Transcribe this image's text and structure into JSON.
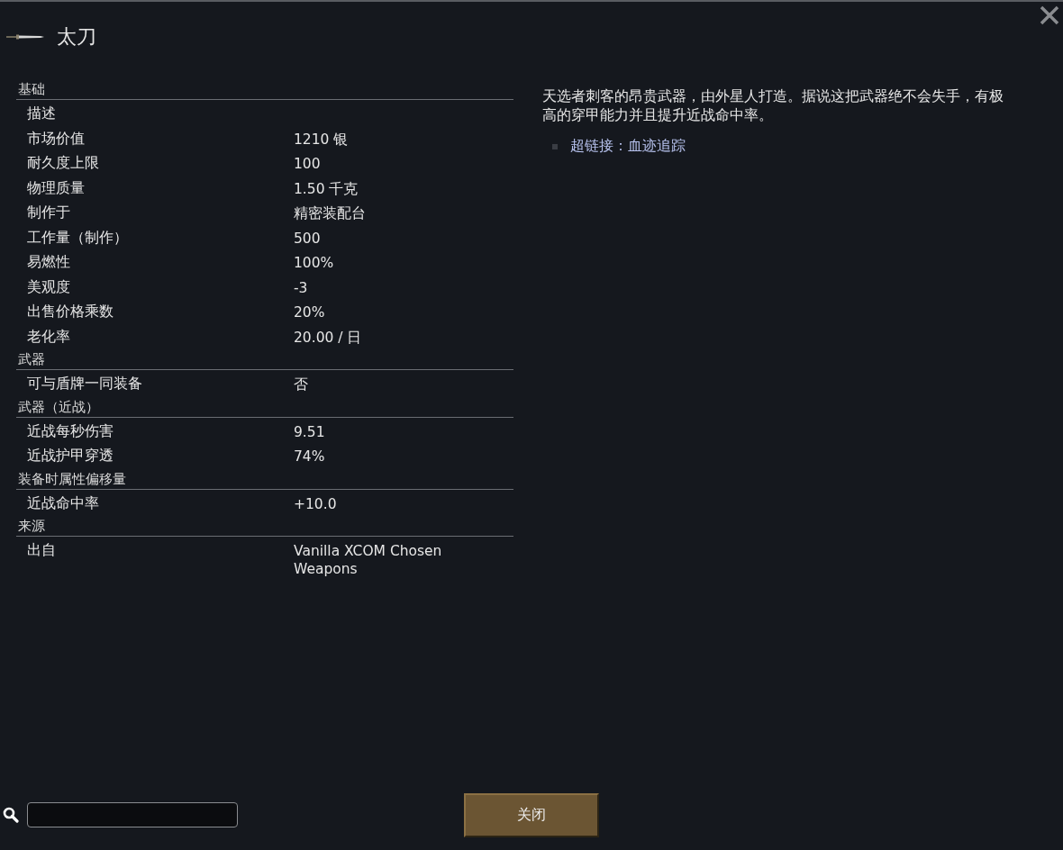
{
  "title": "太刀",
  "sections": [
    {
      "heading": "基础",
      "rows": [
        {
          "label": "描述"
        },
        {
          "label": "市场价值",
          "value": "1210 银"
        },
        {
          "label": "耐久度上限",
          "value": "100"
        },
        {
          "label": "物理质量",
          "value": "1.50 千克"
        },
        {
          "label": "制作于",
          "value": "精密装配台"
        },
        {
          "label": "工作量（制作）",
          "value": "500"
        },
        {
          "label": "易燃性",
          "value": "100%"
        },
        {
          "label": "美观度",
          "value": "-3"
        },
        {
          "label": "出售价格乘数",
          "value": "20%"
        },
        {
          "label": "老化率",
          "value": "20.00 / 日"
        }
      ]
    },
    {
      "heading": "武器",
      "rows": [
        {
          "label": "可与盾牌一同装备",
          "value": "否"
        }
      ]
    },
    {
      "heading": "武器（近战）",
      "rows": [
        {
          "label": "近战每秒伤害",
          "value": "9.51"
        },
        {
          "label": "近战护甲穿透",
          "value": "74%"
        }
      ]
    },
    {
      "heading": "装备时属性偏移量",
      "rows": [
        {
          "label": "近战命中率",
          "value": "+10.0"
        }
      ]
    },
    {
      "heading": "来源",
      "rows": [
        {
          "label": "出自",
          "value": "Vanilla XCOM Chosen Weapons"
        }
      ]
    }
  ],
  "description": "天选者刺客的昂贵武器，由外星人打造。据说这把武器绝不会失手，有极高的穿甲能力并且提升近战命中率。",
  "links": [
    "超链接：血迹追踪"
  ],
  "close_button": "关闭"
}
